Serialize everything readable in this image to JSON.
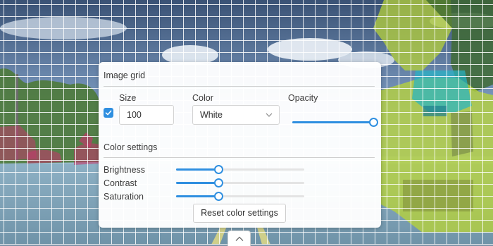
{
  "image_grid": {
    "title": "Image grid",
    "enabled": true,
    "size_label": "Size",
    "size_value": "100",
    "color_label": "Color",
    "color_value": "White",
    "opacity_label": "Opacity",
    "opacity_level": 1.0
  },
  "color_settings": {
    "title": "Color settings",
    "brightness_label": "Brightness",
    "brightness_level": 0.33,
    "contrast_label": "Contrast",
    "contrast_level": 0.33,
    "saturation_label": "Saturation",
    "saturation_level": 0.33,
    "reset_label": "Reset color settings"
  },
  "icons": {
    "checkbox": "checkmark-icon",
    "dropdown": "chevron-down-icon",
    "collapse": "chevron-up-icon"
  },
  "colors": {
    "accent": "#2f8fe0",
    "grid_line": "#ffffff",
    "vegetation_mask": "#b7d23a",
    "vehicle_mask": "#c0396a",
    "equipment_mask": "#25b5c8"
  }
}
